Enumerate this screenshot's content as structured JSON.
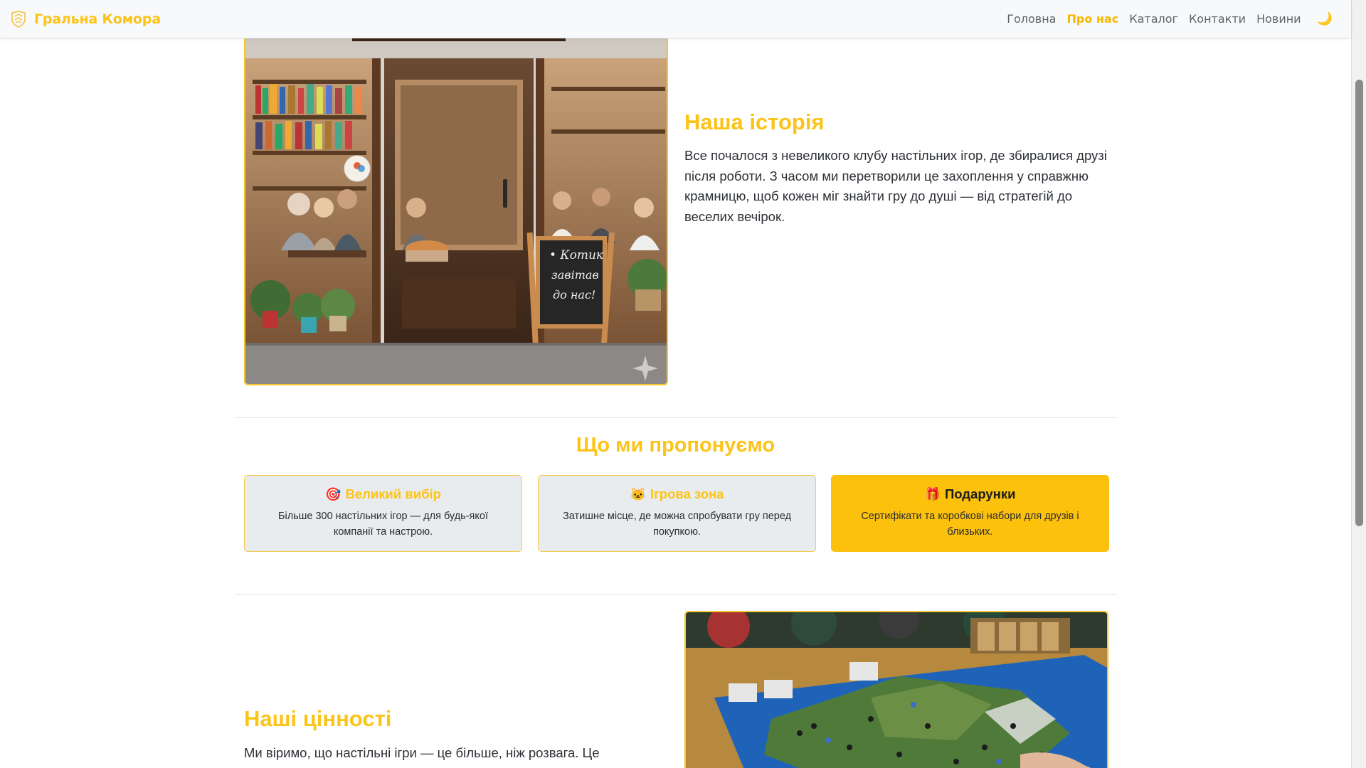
{
  "brand": {
    "name": "Гральна Комора",
    "icon": "shield-logo-icon"
  },
  "nav": {
    "items": [
      {
        "label": "Головна",
        "active": false
      },
      {
        "label": "Про нас",
        "active": true
      },
      {
        "label": "Каталог",
        "active": false
      },
      {
        "label": "Контакти",
        "active": false
      },
      {
        "label": "Новини",
        "active": false
      }
    ],
    "theme_toggle": "🌙"
  },
  "story": {
    "title": "Наша історія",
    "text": "Все почалося з невеликого клубу настільних ігор, де збиралися друзі після роботи. З часом ми перетворили це захоплення у справжню крамницю, щоб кожен міг знайти гру до душі — від стратегій до веселих вечірок.",
    "image_sign": [
      "• Котик",
      "завітав",
      "до нас!"
    ]
  },
  "offers": {
    "title": "Що ми пропонуємо",
    "cards": [
      {
        "icon": "🎯",
        "title": "Великий вибір",
        "desc": "Більше 300 настільних ігор — для будь-якої компанії та настрою.",
        "highlight": false
      },
      {
        "icon": "🐱",
        "title": "Ігрова зона",
        "desc": "Затишне місце, де можна спробувати гру перед покупкою.",
        "highlight": false
      },
      {
        "icon": "🎁",
        "title": "Подарунки",
        "desc": "Сертифікати та коробкові набори для друзів і близьких.",
        "highlight": true
      }
    ]
  },
  "values": {
    "title": "Наші цінності",
    "text": "Ми віримо, що настільні ігри — це більше, ніж розвага. Це"
  },
  "colors": {
    "accent": "#fcc419",
    "card_bg": "#e9ecef",
    "card_highlight": "#fcc10d"
  }
}
